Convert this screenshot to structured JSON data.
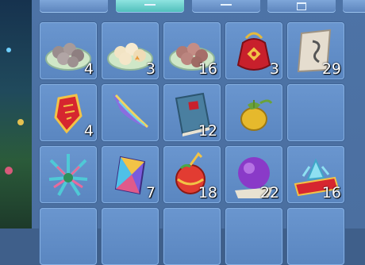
{
  "tabs": [
    {
      "name": "tab-1",
      "active": false,
      "icon": "none"
    },
    {
      "name": "tab-2",
      "active": true,
      "icon": "dash-icon"
    },
    {
      "name": "tab-3",
      "active": false,
      "icon": "dash-icon"
    },
    {
      "name": "tab-4",
      "active": false,
      "icon": "box-icon"
    }
  ],
  "slots": [
    {
      "item": "grey-dumplings-plate-icon",
      "count": "4"
    },
    {
      "item": "sesame-balls-plate-icon",
      "count": "3"
    },
    {
      "item": "red-bean-balls-plate-icon",
      "count": "16"
    },
    {
      "item": "red-lucky-bag-icon",
      "count": "3"
    },
    {
      "item": "ancient-scroll-icon",
      "count": "29"
    },
    {
      "item": "red-talisman-icon",
      "count": "4"
    },
    {
      "item": "rainbow-feather-icon",
      "count": ""
    },
    {
      "item": "blue-book-icon",
      "count": "12"
    },
    {
      "item": "golden-fruit-icon",
      "count": ""
    },
    {
      "item": "empty-slot",
      "count": ""
    },
    {
      "item": "crystal-firework-icon",
      "count": ""
    },
    {
      "item": "rainbow-gem-icon",
      "count": "7"
    },
    {
      "item": "red-lantern-fruit-icon",
      "count": "18"
    },
    {
      "item": "purple-orb-icon",
      "count": "22"
    },
    {
      "item": "crystal-carpet-icon",
      "count": "16"
    },
    {
      "item": "empty-slot",
      "count": ""
    },
    {
      "item": "empty-slot",
      "count": ""
    },
    {
      "item": "empty-slot",
      "count": ""
    },
    {
      "item": "empty-slot",
      "count": ""
    },
    {
      "item": "empty-slot",
      "count": ""
    }
  ]
}
